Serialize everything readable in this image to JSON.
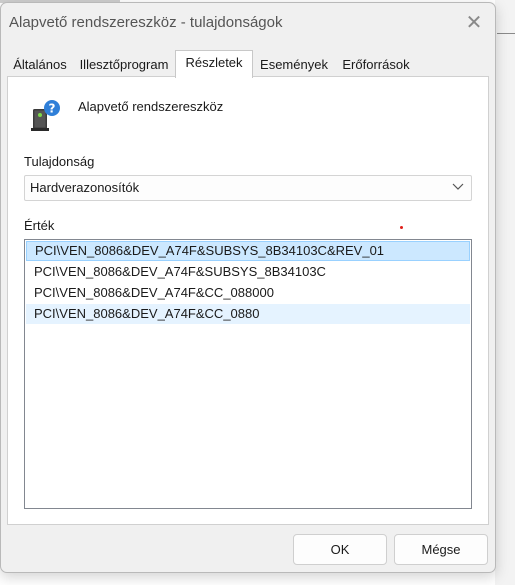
{
  "window": {
    "title": "Alapvető rendszereszköz - tulajdonságok"
  },
  "tabs": [
    {
      "label": "Általános"
    },
    {
      "label": "Illesztőprogram"
    },
    {
      "label": "Részletek",
      "selected": true
    },
    {
      "label": "Események"
    },
    {
      "label": "Erőforrások"
    }
  ],
  "device": {
    "name": "Alapvető rendszereszköz",
    "icon": "device-question-icon"
  },
  "property": {
    "label": "Tulajdonság",
    "selected_value": "Hardverazonosítók"
  },
  "value": {
    "label": "Érték",
    "items": [
      "PCI\\VEN_8086&DEV_A74F&SUBSYS_8B34103C&REV_01",
      "PCI\\VEN_8086&DEV_A74F&SUBSYS_8B34103C",
      "PCI\\VEN_8086&DEV_A74F&CC_088000",
      "PCI\\VEN_8086&DEV_A74F&CC_0880"
    ]
  },
  "buttons": {
    "ok": "OK",
    "cancel": "Mégse"
  },
  "colors": {
    "selection": "#cce8ff",
    "hover": "#e5f3ff",
    "marker": "#e0201a"
  }
}
